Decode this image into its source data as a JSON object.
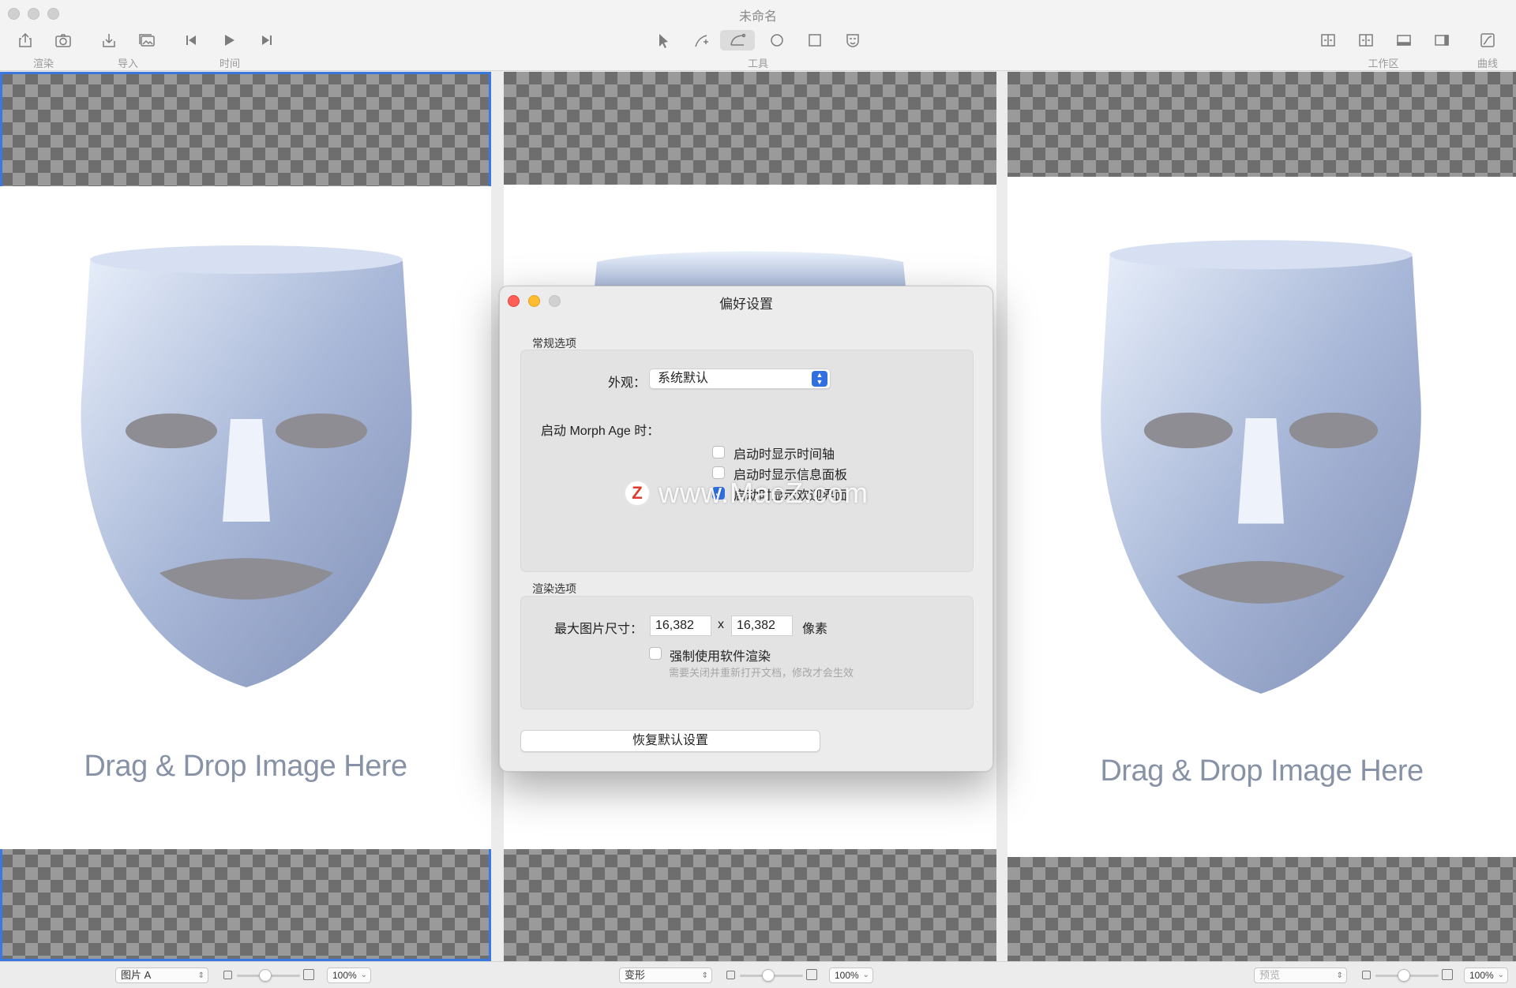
{
  "window": {
    "title": "未命名"
  },
  "toolbar": {
    "groups": {
      "render": "渲染",
      "import": "导入",
      "time": "时间",
      "tools": "工具",
      "workspace": "工作区",
      "curves": "曲线"
    }
  },
  "panels": {
    "left": {
      "drop_text": "Drag & Drop Image Here"
    },
    "right": {
      "drop_text": "Drag & Drop Image Here"
    }
  },
  "statusbar": {
    "left_select": "图片 A",
    "center_select": "变形",
    "right_select": "预览",
    "zoom_left": "100%",
    "zoom_center": "100%",
    "zoom_right": "100%"
  },
  "preferences": {
    "title": "偏好设置",
    "general_section": "常规选项",
    "appearance_label": "外观：",
    "appearance_value": "系统默认",
    "on_launch_label": "启动 Morph Age 时：",
    "options": [
      {
        "label": "启动时显示时间轴",
        "checked": false
      },
      {
        "label": "启动时显示信息面板",
        "checked": false
      },
      {
        "label": "启动时显示欢迎界面",
        "checked": true
      }
    ],
    "render_section": "渲染选项",
    "max_size_label": "最大图片尺寸：",
    "max_width": "16,382",
    "size_separator": "x",
    "max_height": "16,382",
    "unit": "像素",
    "force_software_label": "强制使用软件渲染",
    "force_software_checked": false,
    "force_software_hint": "需要关闭并重新打开文档，修改才会生效",
    "restore_button": "恢复默认设置"
  },
  "watermark": {
    "logo": "Z",
    "text": "www.MacZ.com"
  },
  "colors": {
    "accent": "#2f6fe0",
    "selection_outline": "#3a78e0",
    "close": "#ff5f57",
    "minimize": "#febc2e",
    "disabled": "#d0d0d0"
  }
}
